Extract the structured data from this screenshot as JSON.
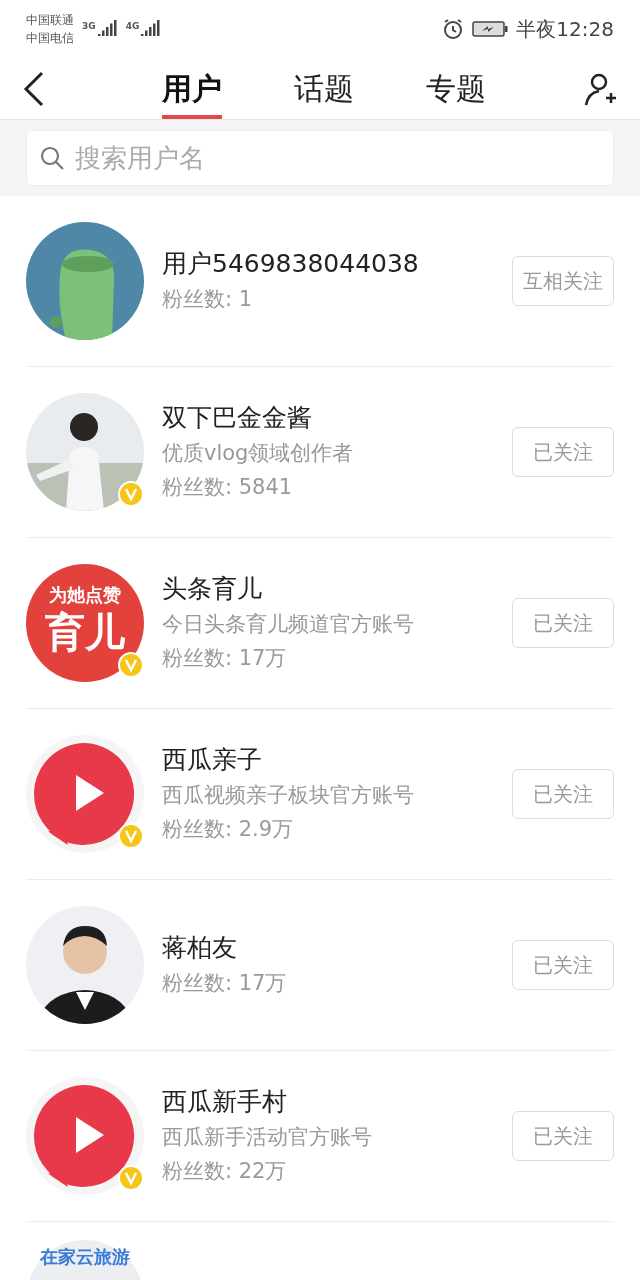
{
  "status_bar": {
    "carriers": [
      "中国联通",
      "中国电信"
    ],
    "networks": [
      "3G",
      "4G"
    ],
    "time": "半夜12:28"
  },
  "tabs": [
    {
      "label": "用户",
      "selected": true
    },
    {
      "label": "话题",
      "selected": false
    },
    {
      "label": "专题",
      "selected": false
    }
  ],
  "search": {
    "placeholder": "搜索用户名"
  },
  "users": [
    {
      "kind": "monster",
      "name": "用户5469838044038",
      "lines": [
        "粉丝数: 1"
      ],
      "verified": false,
      "button": "互相关注"
    },
    {
      "name": "双下巴金金酱",
      "lines": [
        "优质vlog领域创作者",
        "粉丝数: 5841"
      ],
      "verified": true,
      "button": "已关注"
    },
    {
      "kind": "logo",
      "avatar_text": [
        "为她点赞",
        "育儿"
      ],
      "name": "头条育儿",
      "lines": [
        "今日头条育儿频道官方账号",
        "粉丝数: 17万"
      ],
      "verified": true,
      "button": "已关注"
    },
    {
      "kind": "play",
      "name": "西瓜亲子",
      "lines": [
        "西瓜视频亲子板块官方账号",
        "粉丝数: 2.9万"
      ],
      "verified": true,
      "button": "已关注"
    },
    {
      "kind": "person",
      "name": "蒋柏友",
      "lines": [
        "粉丝数: 17万"
      ],
      "verified": false,
      "button": "已关注"
    },
    {
      "kind": "play",
      "name": "西瓜新手村",
      "lines": [
        "西瓜新手活动官方账号",
        "粉丝数: 22万"
      ],
      "verified": true,
      "button": "已关注"
    },
    {
      "kind": "banner",
      "avatar_text": [
        "在家云旅游"
      ]
    }
  ]
}
